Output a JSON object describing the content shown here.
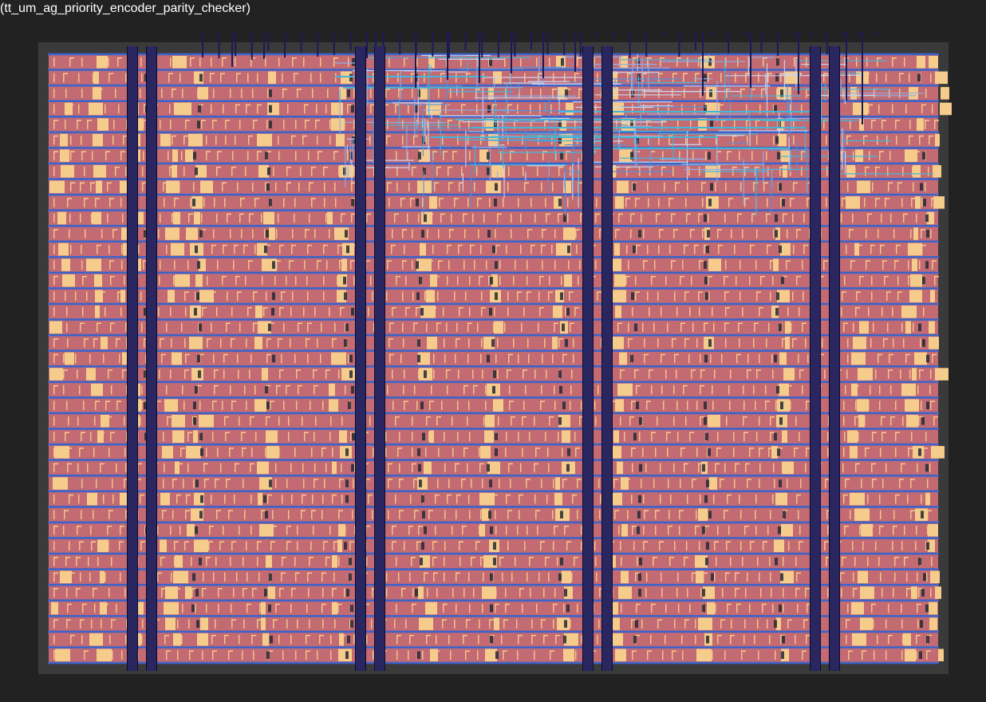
{
  "viewer": {
    "title": "(tt_um_ag_priority_encoder_parity_checker)"
  },
  "colors": {
    "background": "#222222",
    "die_area": "#3a3a3a",
    "cell_fill": "#c46a73",
    "filler": "#f6cc8d",
    "metal1": "#3b63c8",
    "metal2": "#5b8fd6",
    "metal3": "#43b6d9",
    "power_strap": "#2a2660",
    "power_strap_edge": "#0c0b2a",
    "pin": "#1d1a55",
    "text": "#ffffff"
  },
  "layout": {
    "kind": "chip-layout",
    "routed_region": "top-center"
  }
}
